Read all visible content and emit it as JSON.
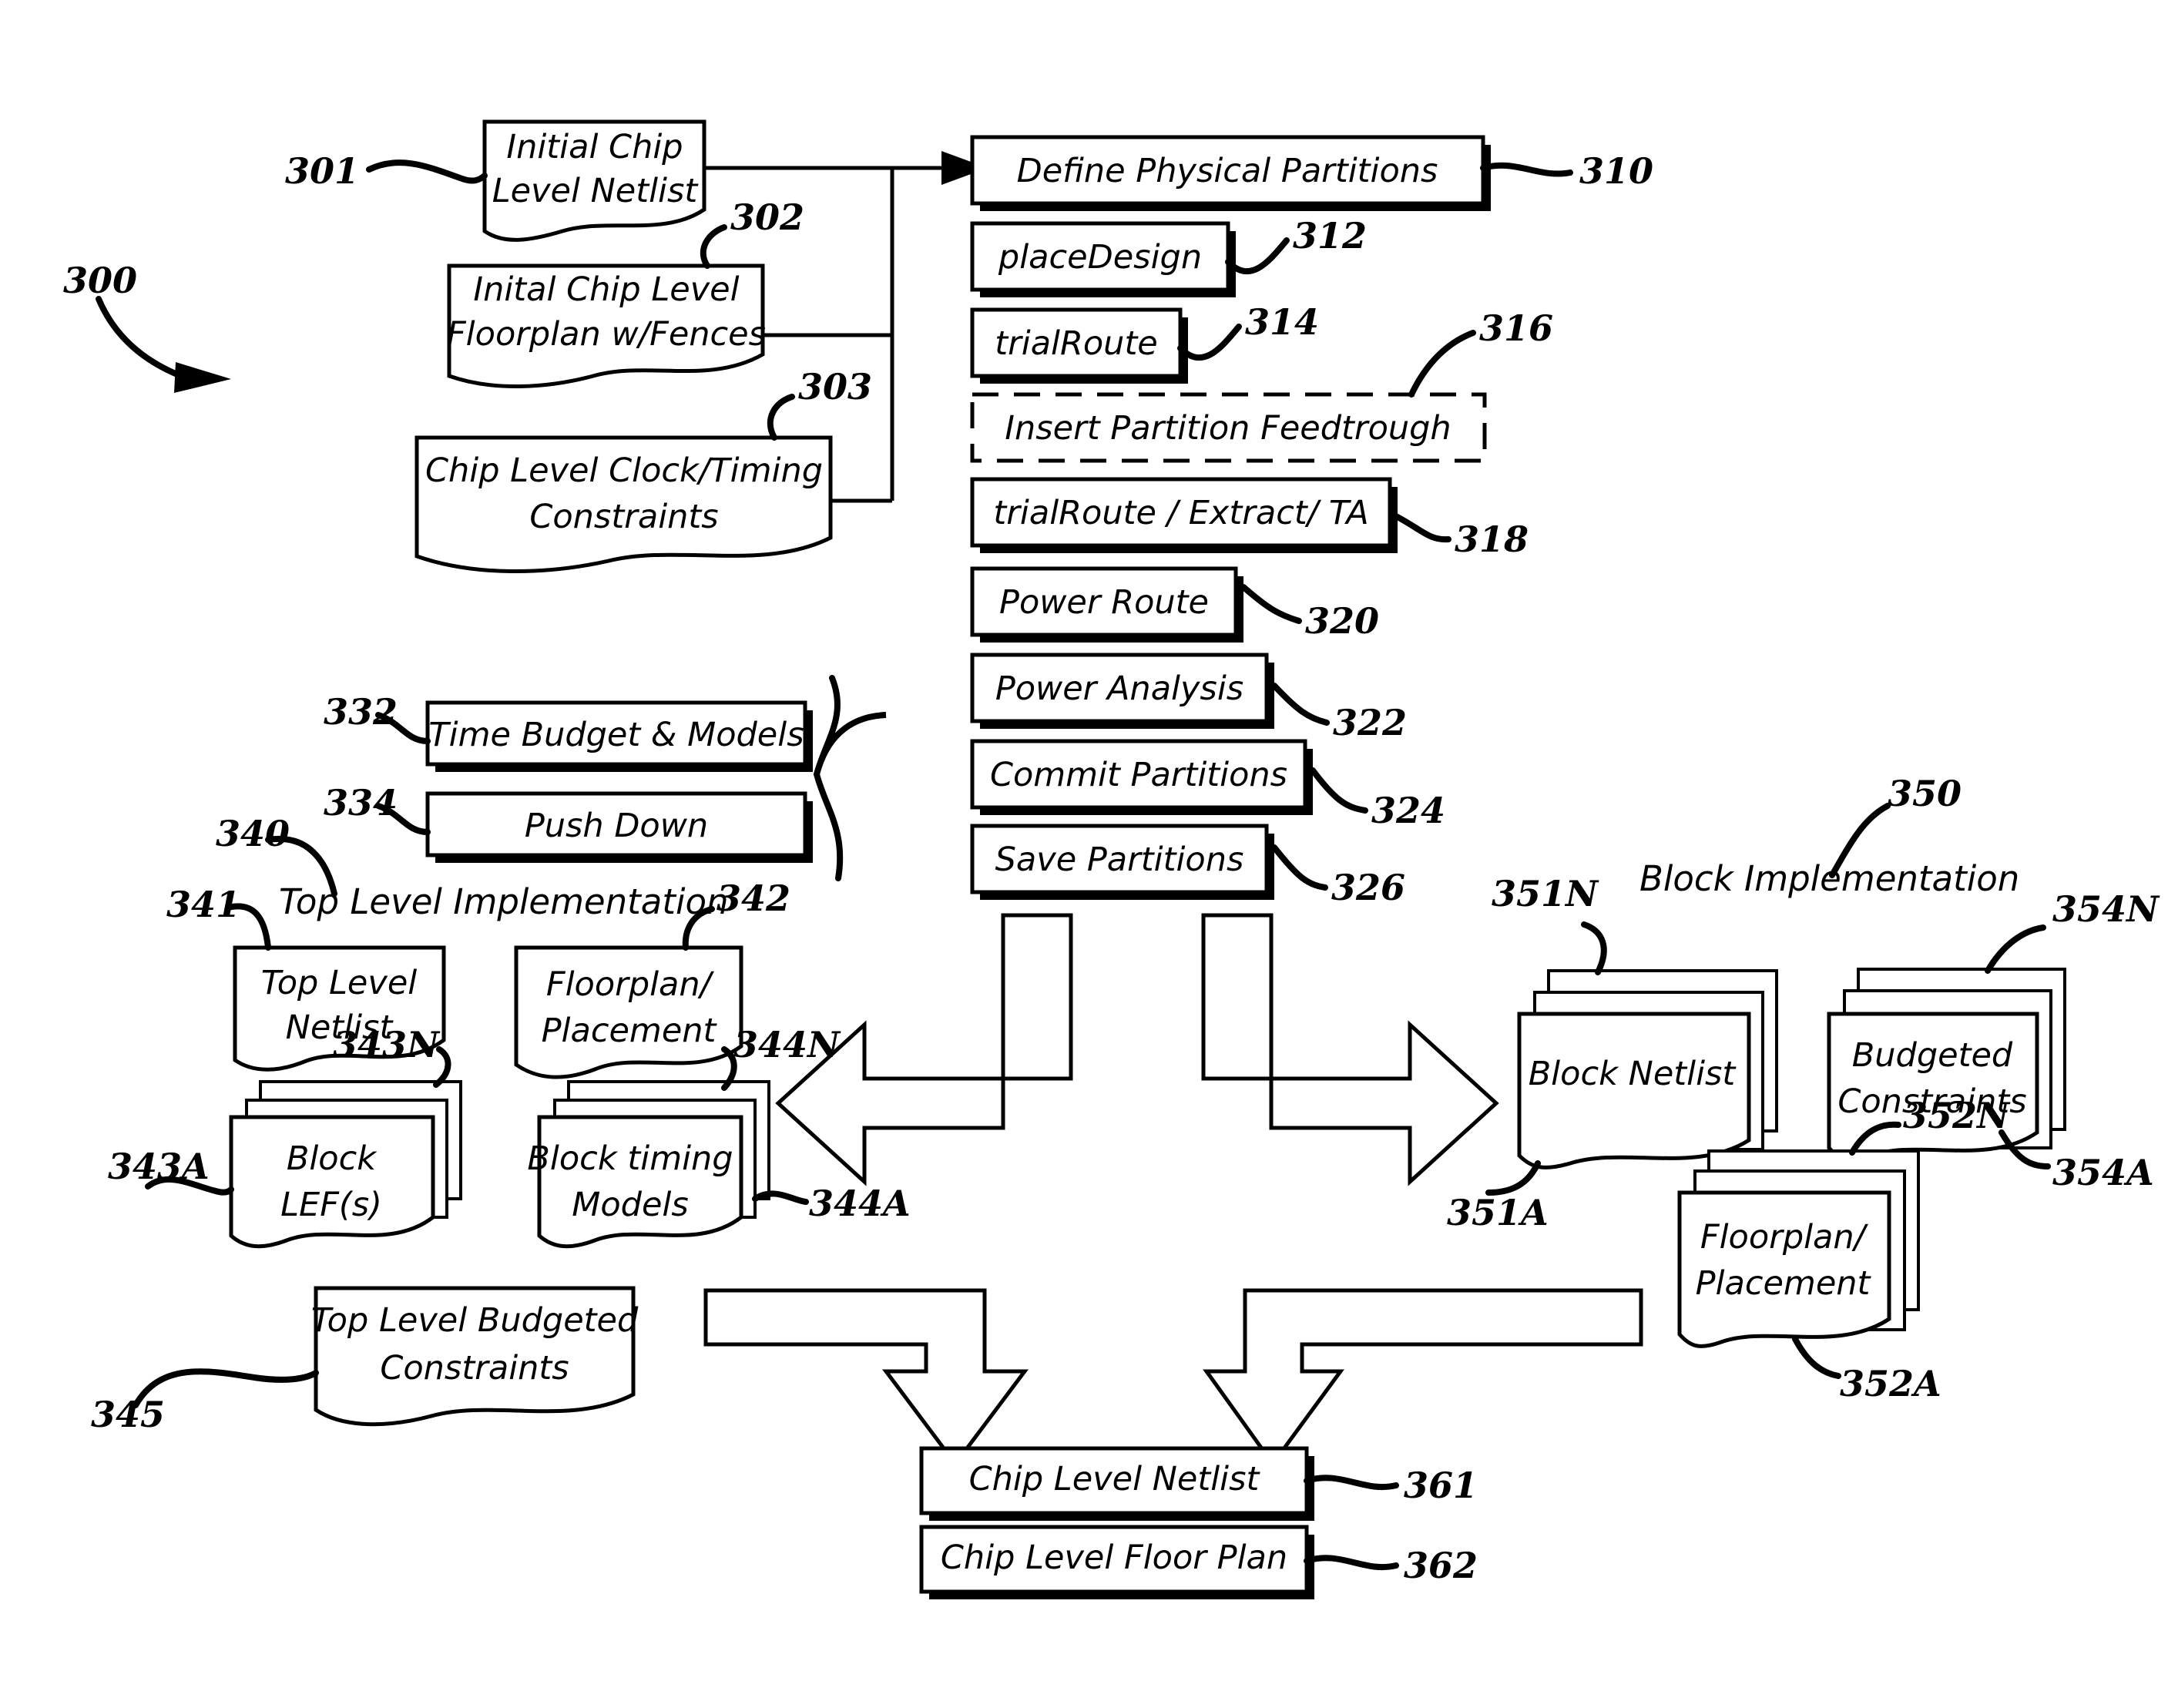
{
  "figure": {
    "ref_300": "300",
    "title_top_level": "Top Level Implementation",
    "title_block_level": "Block Implementation",
    "ref_340": "340",
    "ref_350": "350"
  },
  "inputs": [
    {
      "ref": "301",
      "label_line1": "Initial Chip",
      "label_line2": "Level Netlist"
    },
    {
      "ref": "302",
      "label_line1": "Inital Chip Level",
      "label_line2": "Floorplan w/Fences"
    },
    {
      "ref": "303",
      "label_line1": "Chip Level Clock/Timing",
      "label_line2": "Constraints"
    }
  ],
  "process_steps": [
    {
      "ref": "310",
      "label": "Define Physical Partitions",
      "style": "solid"
    },
    {
      "ref": "312",
      "label": "placeDesign",
      "style": "solid"
    },
    {
      "ref": "314",
      "label": "trialRoute",
      "style": "solid"
    },
    {
      "ref": "316",
      "label": "Insert Partition Feedtrough",
      "style": "dashed"
    },
    {
      "ref": "318",
      "label": "trialRoute / Extract/ TA",
      "style": "solid"
    },
    {
      "ref": "320",
      "label": "Power Route",
      "style": "solid"
    },
    {
      "ref": "322",
      "label": "Power Analysis",
      "style": "solid"
    },
    {
      "ref": "324",
      "label": "Commit Partitions",
      "style": "solid"
    },
    {
      "ref": "326",
      "label": "Save Partitions",
      "style": "solid"
    }
  ],
  "budget_steps": [
    {
      "ref": "332",
      "label": "Time Budget & Models"
    },
    {
      "ref": "334",
      "label": "Push Down"
    }
  ],
  "top_level_artifacts": [
    {
      "ref": "341",
      "label_line1": "Top Level",
      "label_line2": "Netlist",
      "stacked": false
    },
    {
      "ref": "342",
      "label_line1": "Floorplan/",
      "label_line2": "Placement",
      "stacked": false
    },
    {
      "ref_n": "343N",
      "ref_a": "343A",
      "label_line1": "Block",
      "label_line2": "LEF(s)",
      "stacked": true
    },
    {
      "ref_n": "344N",
      "ref_a": "344A",
      "label_line1": "Block timing",
      "label_line2": "Models",
      "stacked": true
    },
    {
      "ref": "345",
      "label_line1": "Top Level Budgeted",
      "label_line2": "Constraints",
      "stacked": false
    }
  ],
  "block_level_artifacts": [
    {
      "ref_n": "351N",
      "ref_a": "351A",
      "label_line1": "Block Netlist",
      "label_line2": "",
      "stacked": true
    },
    {
      "ref_n": "354N",
      "ref_a": "354A",
      "label_line1": "Budgeted",
      "label_line2": "Constraints",
      "stacked": true
    },
    {
      "ref_n": "352N",
      "ref_a": "352A",
      "label_line1": "Floorplan/",
      "label_line2": "Placement",
      "stacked": true
    }
  ],
  "outputs": [
    {
      "ref": "361",
      "label": "Chip Level Netlist"
    },
    {
      "ref": "362",
      "label": "Chip Level Floor Plan"
    }
  ],
  "colors": {
    "ink": "#000000",
    "paper": "#ffffff"
  }
}
